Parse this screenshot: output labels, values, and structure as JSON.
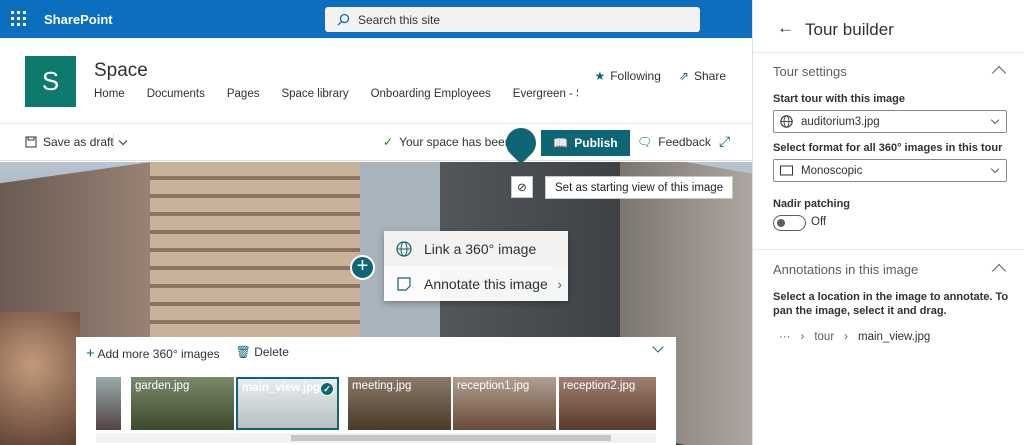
{
  "suite": {
    "brand": "SharePoint",
    "search_placeholder": "Search this site"
  },
  "site": {
    "logo_letter": "S",
    "title": "Space",
    "nav": [
      "Home",
      "Documents",
      "Pages",
      "Space library",
      "Onboarding Employees",
      "Evergreen - Sta"
    ],
    "following_label": "Following",
    "share_label": "Share"
  },
  "commandbar": {
    "save_draft_label": "Save as draft",
    "status_text": "Your space has been s",
    "publish_label": "Publish",
    "feedback_label": "Feedback"
  },
  "canvas": {
    "starting_view_label": "Set as starting view of this image",
    "context_menu": [
      "Link a 360° image",
      "Annotate this image"
    ],
    "tray": {
      "add_label": "Add more 360° images",
      "delete_label": "Delete",
      "thumbnails": [
        "",
        "garden.jpg",
        "main_view.jpg",
        "meeting.jpg",
        "reception1.jpg",
        "reception2.jpg"
      ],
      "selected_index": 2
    }
  },
  "panel": {
    "title": "Tour builder",
    "tour_settings_header": "Tour settings",
    "start_label": "Start tour with this image",
    "start_value": "auditorium3.jpg",
    "format_label": "Select format for all 360° images in this tour",
    "format_value": "Monoscopic",
    "nadir_label": "Nadir patching",
    "nadir_state": "Off",
    "annotations_header": "Annotations in this image",
    "annotations_help": "Select a location in the image to annotate. To pan the image, select it and drag.",
    "breadcrumb": [
      "···",
      "tour",
      "main_view.jpg"
    ]
  },
  "colors": {
    "suite": "#0b6ebf",
    "accent": "#0e6674"
  }
}
